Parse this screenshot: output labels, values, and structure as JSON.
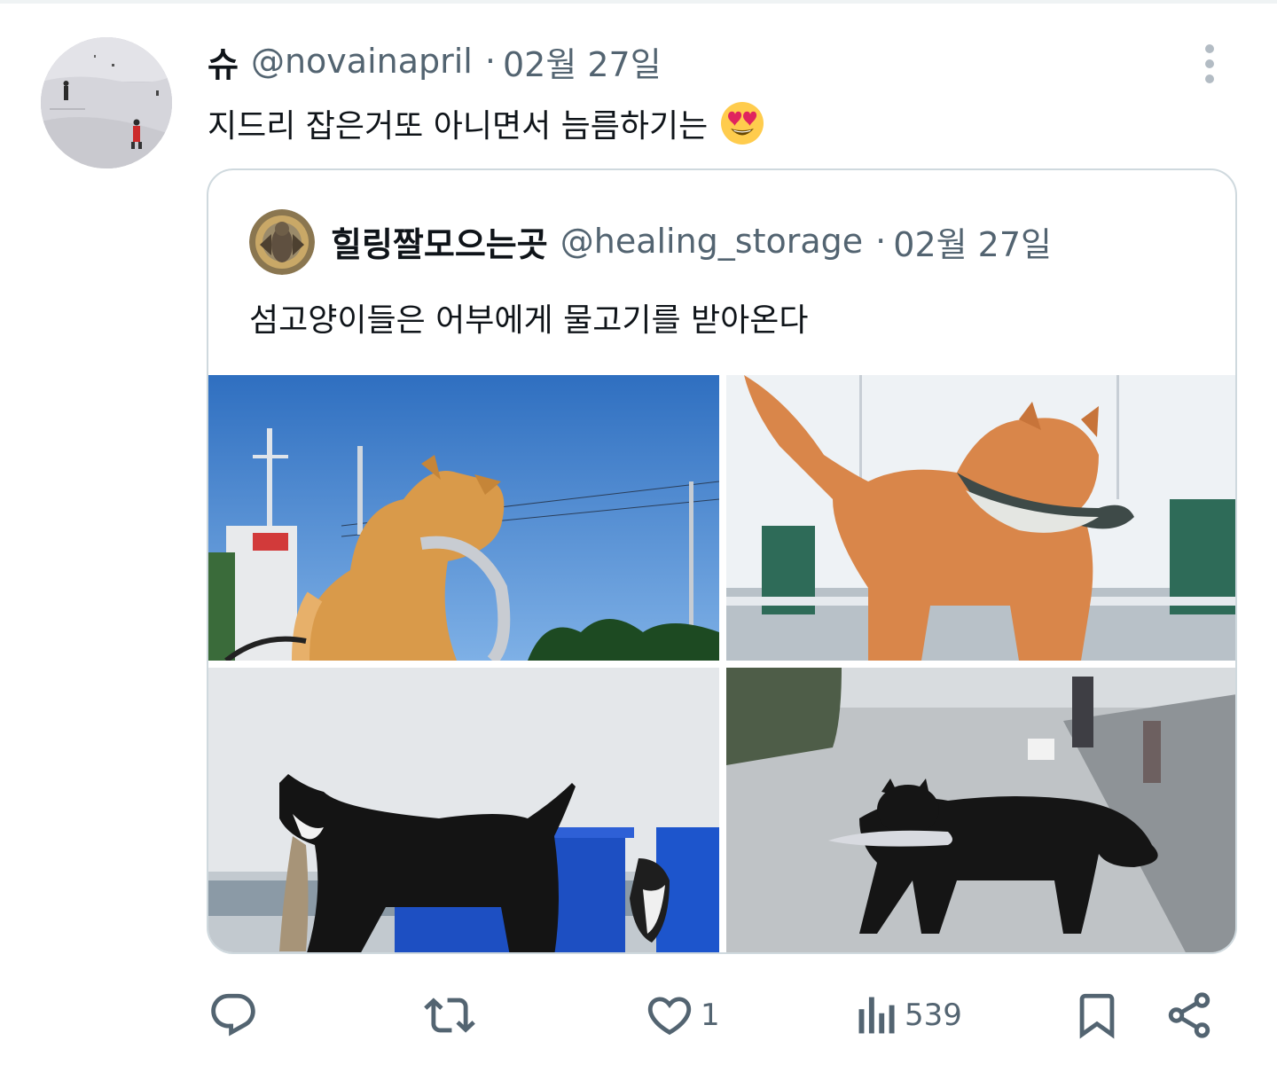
{
  "tweet": {
    "author_name": "슈",
    "author_handle": "@novainapril",
    "separator": "·",
    "date": "02월 27일",
    "text": "지드리 잡은거또 아니면서 늠름하기는",
    "emoji": "heart-eyes-emoji"
  },
  "quote": {
    "author_name": "힐링짤모으는곳",
    "author_handle": "@healing_storage",
    "separator": "·",
    "date": "02월 27일",
    "text": "섬고양이들은 어부에게 물고기를 받아온다",
    "photos": [
      "orange-cat-with-fish-blue-sky",
      "orange-cat-with-fish-harbor",
      "black-white-cat-with-fish-crates",
      "black-cat-with-fish-road"
    ]
  },
  "actions": {
    "reply": {
      "icon": "reply-icon",
      "count": ""
    },
    "retweet": {
      "icon": "retweet-icon",
      "count": ""
    },
    "like": {
      "icon": "heart-icon",
      "count": "1"
    },
    "views": {
      "icon": "views-icon",
      "count": "539"
    },
    "bookmark": {
      "icon": "bookmark-icon",
      "count": ""
    },
    "share": {
      "icon": "share-icon",
      "count": ""
    }
  },
  "colors": {
    "text_primary": "#0f1419",
    "text_secondary": "#536471",
    "border": "#cfd9de"
  }
}
